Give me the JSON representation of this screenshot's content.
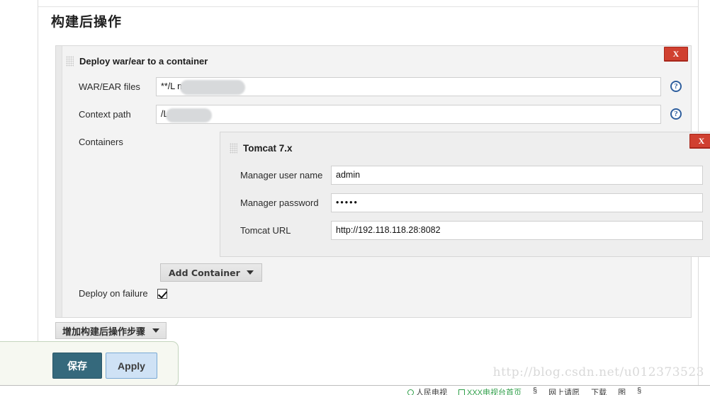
{
  "page": {
    "section_title": "构建后操作"
  },
  "publisher": {
    "title": "Deploy war/ear to a container",
    "grip_icon": "drag-grip-icon",
    "close_label": "X",
    "fields": [
      {
        "label": "WAR/EAR files",
        "value": "**/L          nsole*.war",
        "help_icon": "help-circle-icon",
        "help_label": "?"
      },
      {
        "label": "Context path",
        "value": "/L        nsole",
        "help_icon": "help-circle-icon",
        "help_label": "?"
      }
    ],
    "containers_label": "Containers",
    "deploy_on_failure": {
      "label": "Deploy on failure",
      "checked": true
    },
    "add_container_button": {
      "label": "Add Container",
      "caret_icon": "caret-down-icon"
    }
  },
  "container": {
    "title": "Tomcat 7.x",
    "grip_icon": "drag-grip-icon",
    "close_label": "X",
    "fields": [
      {
        "label": "Manager user name",
        "value": "admin"
      },
      {
        "label": "Manager password",
        "value": "•••••"
      },
      {
        "label": "Tomcat URL",
        "value": "http://192.118.118.28:8082"
      }
    ]
  },
  "footer": {
    "add_step_button": {
      "label": "增加构建后操作步骤",
      "caret_icon": "caret-down-icon"
    },
    "save_label": "保存",
    "apply_label": "Apply"
  },
  "watermark": {
    "text": "http://blog.csdn.net/u012373523"
  },
  "taskbar": {
    "items": [
      {
        "icon": "circle-icon",
        "label": "人民电视"
      },
      {
        "icon": "square-icon",
        "label": "XXX电视台首页"
      },
      {
        "icon": "link-icon",
        "label": ""
      },
      {
        "icon": "link-icon",
        "label": "网上请愿"
      },
      {
        "icon": "pipe-icon",
        "label": "下载"
      },
      {
        "icon": "grid-icon",
        "label": "图"
      },
      {
        "icon": "link-icon",
        "label": ""
      }
    ]
  },
  "colors": {
    "close_red": "#d04030",
    "save_teal": "#35697c",
    "apply_blue": "#cfe2f5",
    "help_blue": "#2f5f9e"
  }
}
